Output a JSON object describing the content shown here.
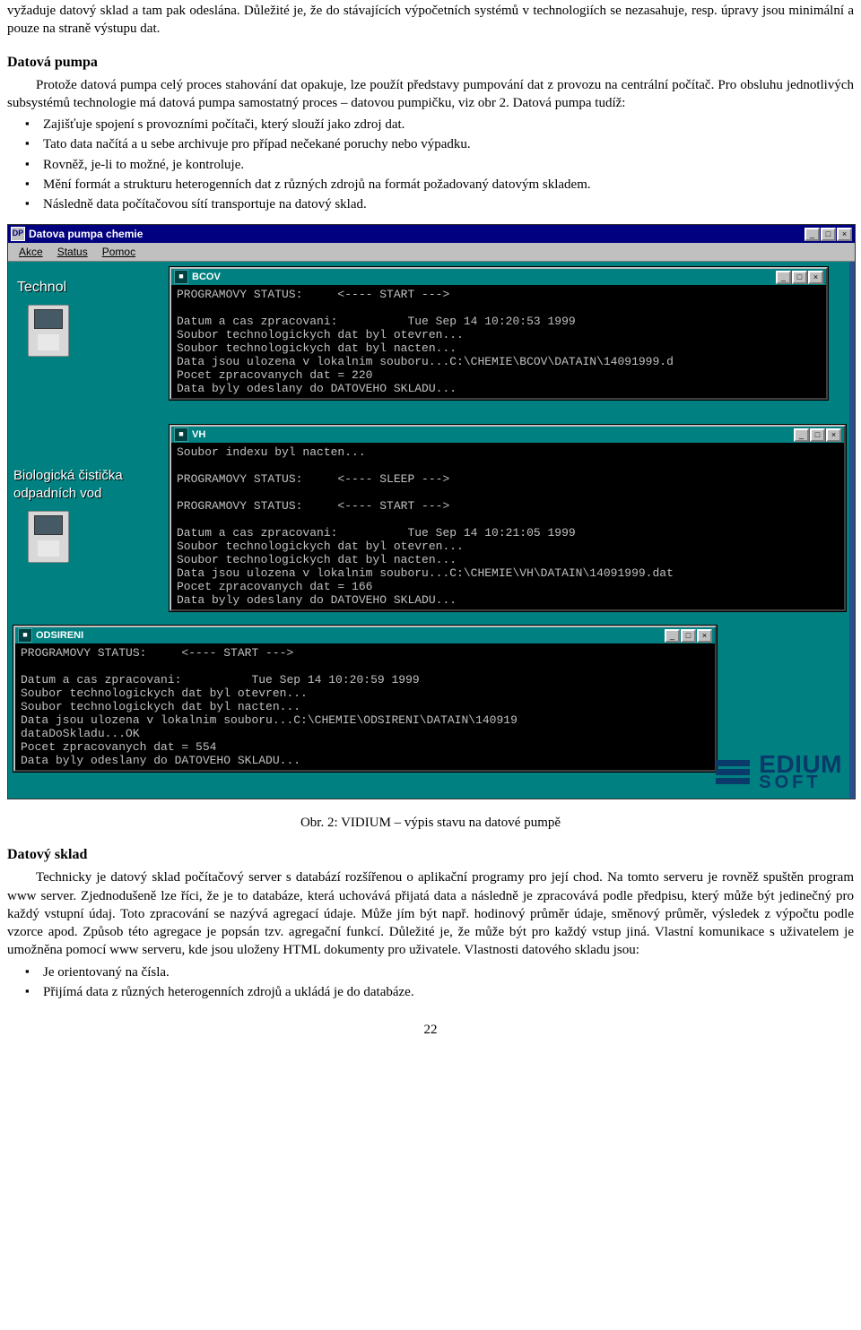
{
  "para_intro": "vyžaduje datový sklad a tam pak odeslána. Důležité je, že do stávajících výpočetních systémů v technologiích se nezasahuje, resp. úpravy jsou minimální a pouze na straně výstupu dat.",
  "heading_pump": "Datová pumpa",
  "para_pump": "Protože datová pumpa celý proces stahování dat opakuje, lze použít představy pumpování dat z provozu na centrální počítač. Pro obsluhu jednotlivých subsystémů technologie má datová pumpa samostatný proces – datovou pumpičku, viz obr 2. Datová pumpa tudíž:",
  "bullets_pump": [
    "Zajišťuje spojení s provozními počítači, který slouží jako zdroj dat.",
    "Tato data načítá a u sebe archivuje pro případ nečekané poruchy nebo výpadku.",
    "Rovněž, je-li to možné, je kontroluje.",
    "Mění formát a strukturu heterogenních dat z různých zdrojů na formát požadovaný datovým skladem.",
    "Následně data počítačovou sítí transportuje na datový sklad."
  ],
  "fig_caption": "Obr. 2: VIDIUM – výpis stavu na datové pumpě",
  "heading_store": "Datový sklad",
  "para_store": "Technicky je datový sklad počítačový server s databází rozšířenou o aplikační programy pro její chod. Na tomto serveru je rovněž spuštěn program www server. Zjednodušeně lze říci, že je to databáze, která uchovává přijatá data a následně je zpracovává podle předpisu, který může být jedinečný pro každý vstupní údaj. Toto zpracování se nazývá agregací údaje. Může jím být např. hodinový průměr údaje, směnový průměr, výsledek z výpočtu podle vzorce apod. Způsob této agregace je popsán tzv. agregační funkcí. Důležité je, že může být pro každý vstup jiná. Vlastní komunikace s uživatelem je umožněna pomocí www serveru, kde jsou uloženy HTML dokumenty pro uživatele. Vlastnosti datového skladu jsou:",
  "bullets_store": [
    "Je orientovaný na čísla.",
    "Přijímá data z různých heterogenních zdrojů a ukládá je do databáze."
  ],
  "page_number": "22",
  "screenshot": {
    "outer_title": "Datova pumpa chemie",
    "menu": {
      "items": [
        "Akce",
        "Status",
        "Pomoc"
      ]
    },
    "desk_labels": {
      "technol": "Technol",
      "bcov1": "Biologická čistička",
      "bcov2": "odpadních vod"
    },
    "logo": {
      "line1": "EDIUM",
      "line2": "SOFT"
    },
    "console_common": {
      "status_start": "PROGRAMOVY STATUS:     <---- START --->",
      "status_sleep": "PROGRAMOVY STATUS:     <---- SLEEP --->",
      "soubor_otevren": "Soubor technologickych dat byl otevren...",
      "soubor_nacten": "Soubor technologickych dat byl nacten...",
      "odeslany": "Data byly odeslany do DATOVEHO SKLADU...",
      "index_nacten": "Soubor indexu byl nacten...",
      "datadoskladu": "dataDoSkladu...OK"
    },
    "windows": {
      "bcov": {
        "title": "BCOV",
        "datum": "Datum a cas zpracovani:          Tue Sep 14 10:20:53 1999",
        "ulozen": "Data jsou ulozena v lokalnim souboru...C:\\CHEMIE\\BCOV\\DATAIN\\14091999.d",
        "pocet": "Pocet zpracovanych dat = 220"
      },
      "vh": {
        "title": "VH",
        "datum": "Datum a cas zpracovani:          Tue Sep 14 10:21:05 1999",
        "ulozen": "Data jsou ulozena v lokalnim souboru...C:\\CHEMIE\\VH\\DATAIN\\14091999.dat",
        "pocet": "Pocet zpracovanych dat = 166"
      },
      "odsireni": {
        "title": "ODSIRENI",
        "datum": "Datum a cas zpracovani:          Tue Sep 14 10:20:59 1999",
        "ulozen": "Data jsou ulozena v lokalnim souboru...C:\\CHEMIE\\ODSIRENI\\DATAIN\\140919",
        "pocet": "Pocet zpracovanych dat = 554"
      }
    }
  }
}
